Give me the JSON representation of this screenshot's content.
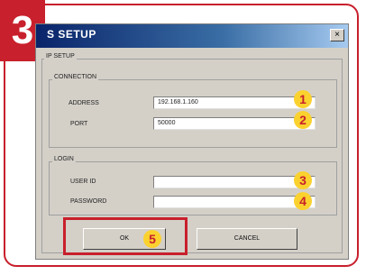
{
  "step_number": "3",
  "window": {
    "title": "S SETUP"
  },
  "ip_setup": {
    "label": "IP SETUP",
    "connection": {
      "label": "CONNECTION",
      "address_label": "ADDRESS",
      "address_value": "192.168.1.160",
      "port_label": "PORT",
      "port_value": "50000"
    },
    "login": {
      "label": "LOGIN",
      "user_id_label": "USER ID",
      "user_id_value": "",
      "password_label": "PASSWORD",
      "password_value": ""
    }
  },
  "buttons": {
    "ok": "OK",
    "cancel": "CANCEL"
  },
  "badges": [
    "1",
    "2",
    "3",
    "4",
    "5"
  ],
  "colors": {
    "accent_red": "#c8202c",
    "badge_yellow": "#fbd12e",
    "dialog_gray": "#d4d0c8",
    "titlebar_blue": "#0a246a"
  }
}
